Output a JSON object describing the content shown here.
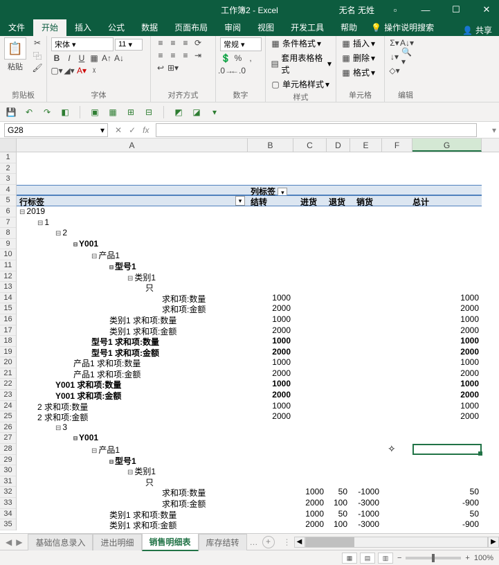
{
  "titlebar": {
    "title": "工作簿2 - Excel",
    "user": "无名 无姓"
  },
  "tabs": {
    "file": "文件",
    "home": "开始",
    "insert": "插入",
    "formulas": "公式",
    "data": "数据",
    "layout": "页面布局",
    "review": "审阅",
    "view": "视图",
    "dev": "开发工具",
    "help": "帮助",
    "tellme": "操作说明搜索",
    "share": "共享"
  },
  "ribbon": {
    "clipboard": {
      "paste": "粘贴",
      "label": "剪贴板"
    },
    "font": {
      "name": "宋体",
      "size": "11",
      "label": "字体"
    },
    "align": {
      "label": "对齐方式"
    },
    "number": {
      "format": "常规",
      "label": "数字"
    },
    "styles": {
      "cond": "条件格式",
      "table": "套用表格格式",
      "cell": "单元格样式",
      "label": "样式"
    },
    "cells": {
      "insert": "插入",
      "delete": "删除",
      "format": "格式",
      "label": "单元格"
    },
    "editing": {
      "label": "编辑"
    }
  },
  "namebox": "G28",
  "col_headers": [
    "A",
    "B",
    "C",
    "D",
    "E",
    "F",
    "G"
  ],
  "pivot": {
    "col_label_hdr": "列标签",
    "row_label_hdr": "行标签",
    "cols": {
      "carry": "结转",
      "in": "进货",
      "return": "退货",
      "sale": "销货",
      "total": "总计"
    },
    "rows": [
      {
        "r": 1,
        "A": "",
        "cls": ""
      },
      {
        "r": 2,
        "A": "",
        "cls": ""
      },
      {
        "r": 3,
        "A": "",
        "cls": ""
      },
      {
        "r": 4,
        "A": "",
        "cls": "",
        "special": "colhdr"
      },
      {
        "r": 5,
        "A": "",
        "cls": "",
        "special": "rowhdr"
      },
      {
        "r": 6,
        "A": "2019",
        "ind": 0,
        "exp": "⊟"
      },
      {
        "r": 7,
        "A": "1",
        "ind": 1,
        "exp": "⊟"
      },
      {
        "r": 8,
        "A": "2",
        "ind": 2,
        "exp": "⊟"
      },
      {
        "r": 9,
        "A": "Y001",
        "ind": 3,
        "exp": "⊟",
        "b": true
      },
      {
        "r": 10,
        "A": "产品1",
        "ind": 4,
        "exp": "⊟"
      },
      {
        "r": 11,
        "A": "型号1",
        "ind": 5,
        "exp": "⊟",
        "b": true
      },
      {
        "r": 12,
        "A": "类别1",
        "ind": 6,
        "exp": "⊟"
      },
      {
        "r": 13,
        "A": "只",
        "ind": 7
      },
      {
        "r": 14,
        "A": "求和项:数量",
        "ind": 8,
        "B": "1000",
        "G": "1000"
      },
      {
        "r": 15,
        "A": "求和项:金额",
        "ind": 8,
        "B": "2000",
        "G": "2000"
      },
      {
        "r": 16,
        "A": "类别1 求和项:数量",
        "ind": 5,
        "B": "1000",
        "G": "1000"
      },
      {
        "r": 17,
        "A": "类别1 求和项:金额",
        "ind": 5,
        "B": "2000",
        "G": "2000"
      },
      {
        "r": 18,
        "A": "型号1 求和项:数量",
        "ind": 4,
        "b": true,
        "B": "1000",
        "G": "1000"
      },
      {
        "r": 19,
        "A": "型号1 求和项:金额",
        "ind": 4,
        "b": true,
        "B": "2000",
        "G": "2000"
      },
      {
        "r": 20,
        "A": "产品1 求和项:数量",
        "ind": 3,
        "B": "1000",
        "G": "1000"
      },
      {
        "r": 21,
        "A": "产品1 求和项:金额",
        "ind": 3,
        "B": "2000",
        "G": "2000"
      },
      {
        "r": 22,
        "A": "Y001 求和项:数量",
        "ind": 2,
        "b": true,
        "B": "1000",
        "G": "1000"
      },
      {
        "r": 23,
        "A": "Y001 求和项:金额",
        "ind": 2,
        "b": true,
        "B": "2000",
        "G": "2000"
      },
      {
        "r": 24,
        "A": "2 求和项:数量",
        "ind": 1,
        "B": "1000",
        "G": "1000"
      },
      {
        "r": 25,
        "A": "2 求和项:金额",
        "ind": 1,
        "B": "2000",
        "G": "2000"
      },
      {
        "r": 26,
        "A": "3",
        "ind": 2,
        "exp": "⊟"
      },
      {
        "r": 27,
        "A": "Y001",
        "ind": 3,
        "exp": "⊟",
        "b": true
      },
      {
        "r": 28,
        "A": "产品1",
        "ind": 4,
        "exp": "⊟"
      },
      {
        "r": 29,
        "A": "型号1",
        "ind": 5,
        "exp": "⊟",
        "b": true
      },
      {
        "r": 30,
        "A": "类别1",
        "ind": 6,
        "exp": "⊟"
      },
      {
        "r": 31,
        "A": "只",
        "ind": 7
      },
      {
        "r": 32,
        "A": "求和项:数量",
        "ind": 8,
        "C": "1000",
        "D": "50",
        "E": "-1000",
        "G": "50"
      },
      {
        "r": 33,
        "A": "求和项:金额",
        "ind": 8,
        "C": "2000",
        "D": "100",
        "E": "-3000",
        "G": "-900"
      },
      {
        "r": 34,
        "A": "类别1 求和项:数量",
        "ind": 5,
        "C": "1000",
        "D": "50",
        "E": "-1000",
        "G": "50"
      },
      {
        "r": 35,
        "A": "类别1 求和项:金额",
        "ind": 5,
        "C": "2000",
        "D": "100",
        "E": "-3000",
        "G": "-900"
      }
    ]
  },
  "sheets": {
    "s1": "基础信息录入",
    "s2": "进出明细",
    "s3": "销售明细表",
    "s4": "库存结转"
  },
  "status": {
    "zoom": "100%"
  }
}
